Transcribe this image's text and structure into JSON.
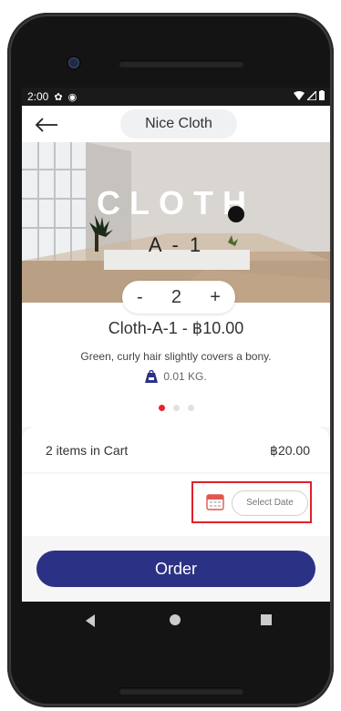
{
  "status": {
    "time": "2:00",
    "icons": [
      "settings-icon",
      "sync-icon",
      "wifi-icon",
      "signal-icon",
      "battery-icon"
    ]
  },
  "appbar": {
    "title": "Nice Cloth",
    "back_icon": "arrow-left-icon"
  },
  "hero": {
    "title": "CLOTH",
    "subtitle": "A - 1"
  },
  "stepper": {
    "minus": "-",
    "quantity": "2",
    "plus": "+"
  },
  "product": {
    "name": "Cloth-A-1 - ฿10.00",
    "description": "Green, curly hair slightly covers a bony.",
    "weight": "0.01 KG.",
    "weight_icon": "weight-icon"
  },
  "carousel": {
    "count": 3,
    "active": 0
  },
  "cart": {
    "text": "2 items in Cart",
    "total": "฿20.00"
  },
  "date": {
    "placeholder": "Select Date",
    "icon": "calendar-icon"
  },
  "order": {
    "label": "Order"
  },
  "colors": {
    "primary": "#2b3285",
    "accent": "#e3262b",
    "highlight": "#e0202a"
  },
  "navbar": {
    "icons": [
      "nav-back-icon",
      "nav-home-icon",
      "nav-recent-icon"
    ]
  }
}
